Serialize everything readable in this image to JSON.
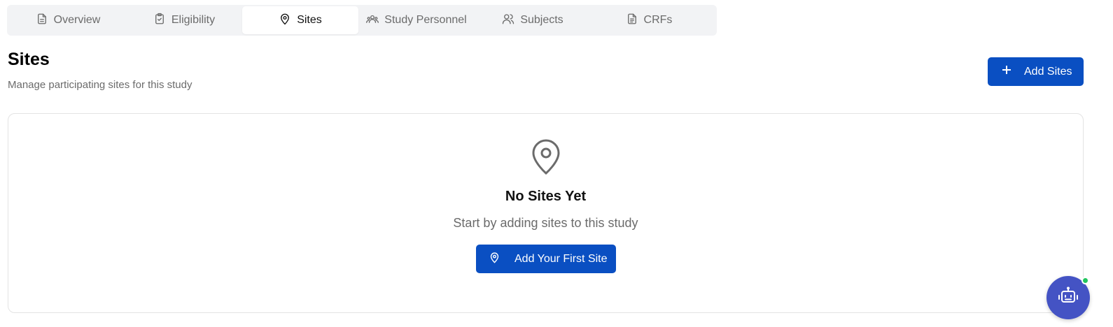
{
  "tabs": [
    {
      "label": "Overview",
      "icon": "document-icon",
      "active": false
    },
    {
      "label": "Eligibility",
      "icon": "clipboard-check-icon",
      "active": false
    },
    {
      "label": "Sites",
      "icon": "map-pin-icon",
      "active": true
    },
    {
      "label": "Study Personnel",
      "icon": "people-group-icon",
      "active": false
    },
    {
      "label": "Subjects",
      "icon": "users-icon",
      "active": false
    },
    {
      "label": "CRFs",
      "icon": "file-text-icon",
      "active": false
    }
  ],
  "header": {
    "title": "Sites",
    "subtitle": "Manage participating sites for this study",
    "add_button_label": "Add Sites"
  },
  "empty_state": {
    "icon": "map-pin-icon",
    "title": "No Sites Yet",
    "description": "Start by adding sites to this study",
    "button_label": "Add Your First Site"
  },
  "assistant": {
    "icon": "robot-icon",
    "status": "online"
  },
  "colors": {
    "primary": "#0a4fc2",
    "assistant": "#4453c4",
    "online": "#22c55e"
  }
}
